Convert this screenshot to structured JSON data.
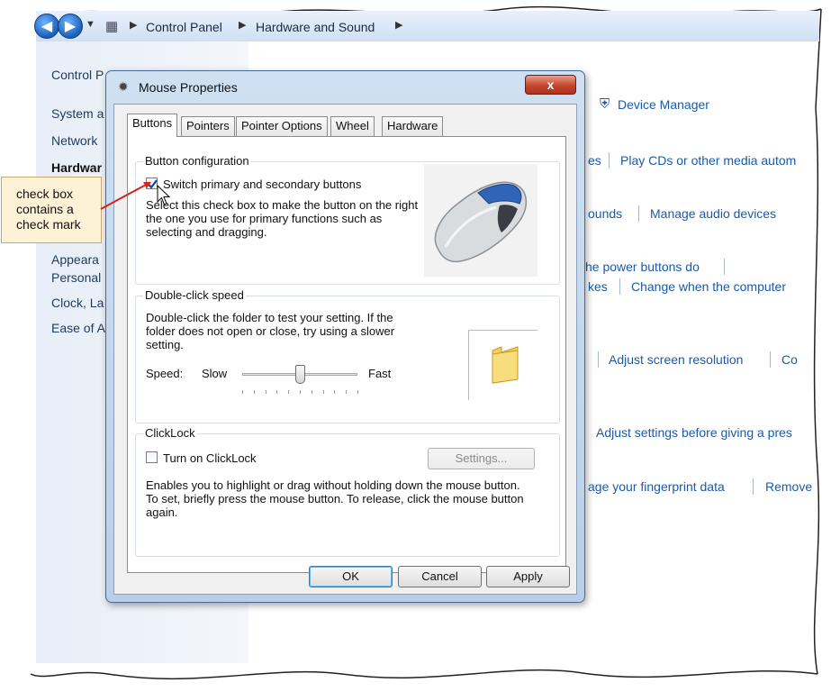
{
  "breadcrumb": {
    "items": [
      "Control Panel",
      "Hardware and Sound"
    ]
  },
  "nav": {
    "items": [
      "Control P",
      "System a",
      "Network",
      "Hardwar",
      "Appeara",
      "Personal",
      "Clock, La",
      "Ease of A"
    ]
  },
  "content": {
    "device_manager": "Device Manager",
    "play_cds": "Play CDs or other media autom",
    "es_frag": "es",
    "ounds_frag": "ounds",
    "manage_audio": "Manage audio devices",
    "power_buttons": "he power buttons do",
    "kes_frag": "kes",
    "change_when": "Change when the computer",
    "adjust_resolution": "Adjust screen resolution",
    "co_frag": "Co",
    "adjust_presentation": "Adjust settings before giving a pres",
    "fingerprint": "age your fingerprint data",
    "remove_frag": "Remove"
  },
  "dialog": {
    "title": "Mouse Properties",
    "close_glyph": "x",
    "tabs": [
      "Buttons",
      "Pointers",
      "Pointer Options",
      "Wheel",
      "Hardware"
    ],
    "button_config": {
      "title": "Button configuration",
      "checkbox_label": "Switch primary and secondary buttons",
      "checked": true,
      "description": "Select this check box to make the button on the right the one you use for primary functions such as selecting and dragging."
    },
    "double_click": {
      "title": "Double-click speed",
      "description": "Double-click the folder to test your setting. If the folder does not open or close, try using a slower setting.",
      "speed_label": "Speed:",
      "slow_label": "Slow",
      "fast_label": "Fast",
      "slider_value": 0.5
    },
    "clicklock": {
      "title": "ClickLock",
      "checkbox_label": "Turn on ClickLock",
      "checked": false,
      "settings_label": "Settings...",
      "description": "Enables you to highlight or drag without holding down the mouse button. To set, briefly press the mouse button. To release, click the mouse button again."
    },
    "ok_label": "OK",
    "cancel_label": "Cancel",
    "apply_label": "Apply"
  },
  "callout": {
    "text": "check box contains a check mark",
    "color": "#fdf1d6"
  },
  "colors": {
    "accent_link": "#1b5aa8",
    "close_button": "#c2452d"
  }
}
